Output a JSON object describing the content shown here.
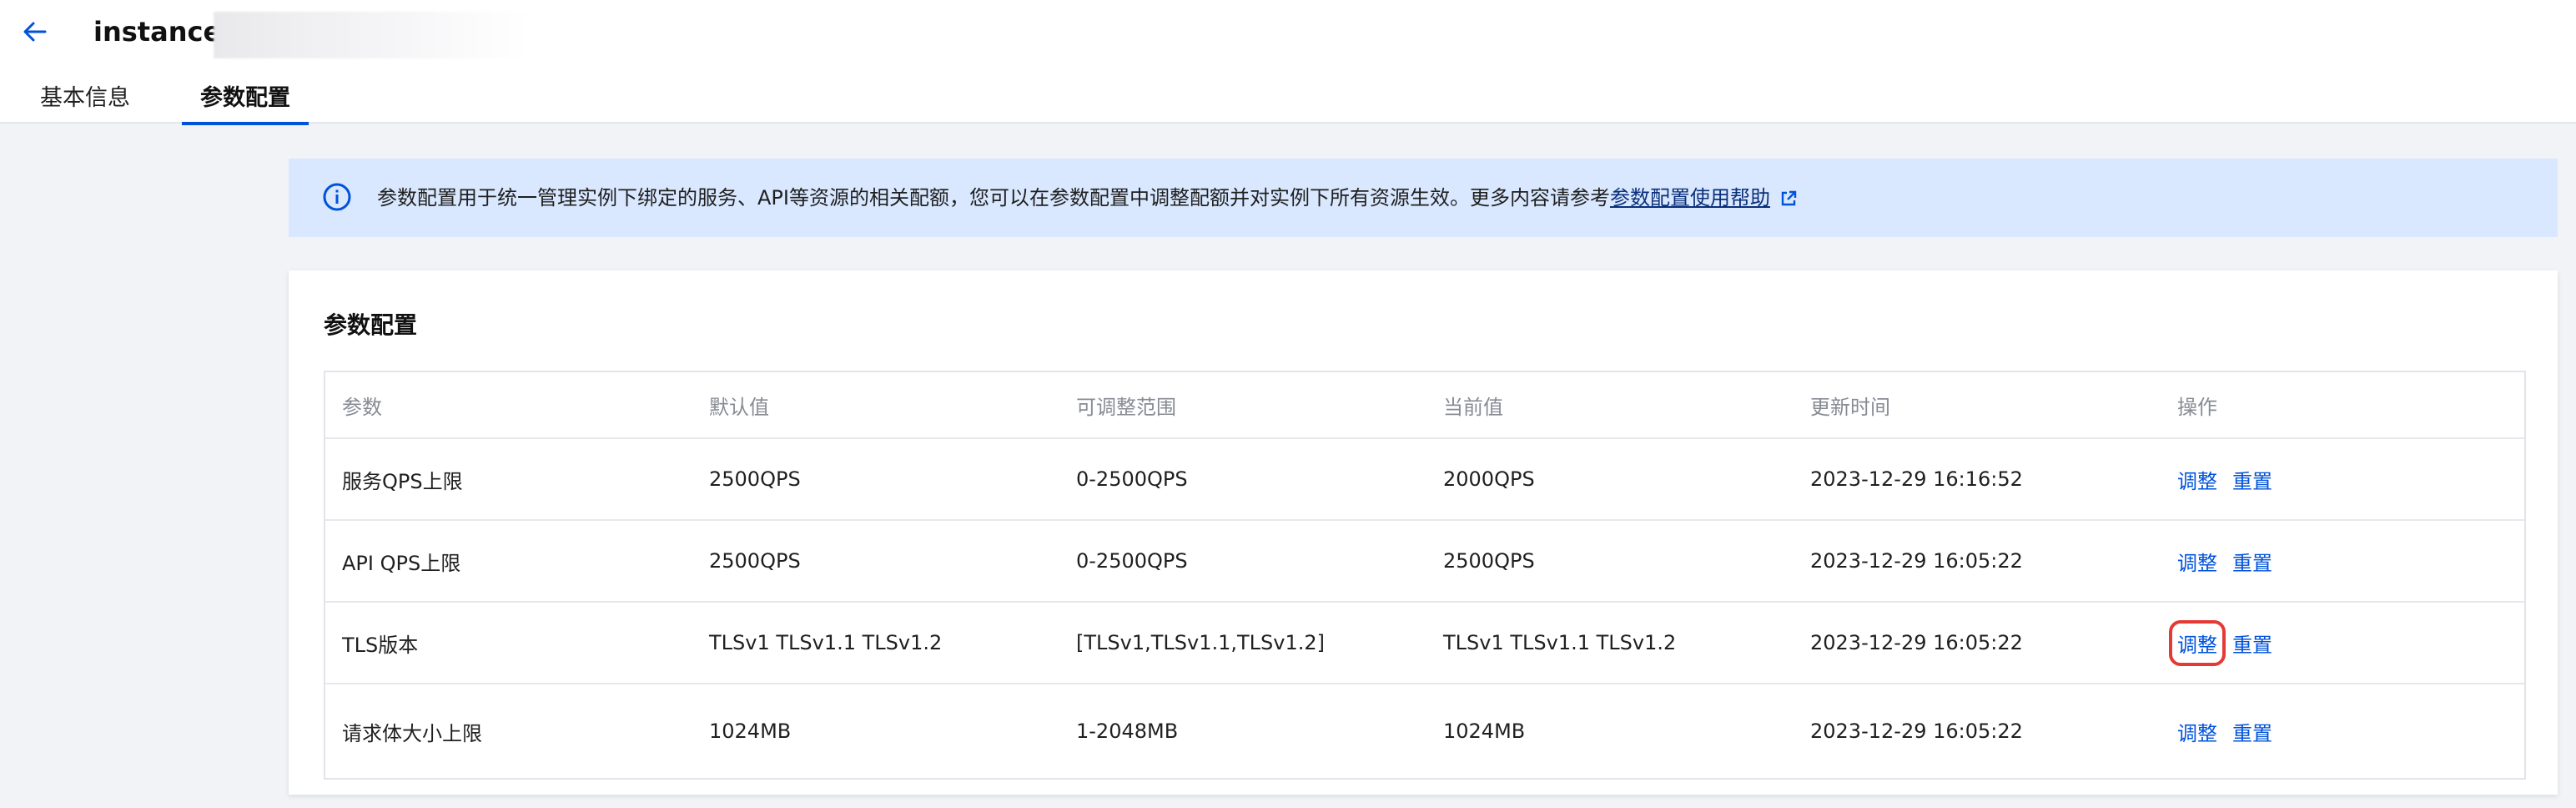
{
  "header": {
    "title": "instance-",
    "tabs": [
      {
        "label": "基本信息"
      },
      {
        "label": "参数配置"
      }
    ]
  },
  "notice": {
    "text": "参数配置用于统一管理实例下绑定的服务、API等资源的相关配额，您可以在参数配置中调整配额并对实例下所有资源生效。更多内容请参考",
    "link": "参数配置使用帮助"
  },
  "card": {
    "title": "参数配置",
    "columns": [
      "参数",
      "默认值",
      "可调整范围",
      "当前值",
      "更新时间",
      "操作"
    ],
    "rows": [
      {
        "param": "服务QPS上限",
        "default": "2500QPS",
        "range": "0-2500QPS",
        "current": "2000QPS",
        "updated": "2023-12-29 16:16:52",
        "adjust": "调整",
        "reset": "重置"
      },
      {
        "param": "API QPS上限",
        "default": "2500QPS",
        "range": "0-2500QPS",
        "current": "2500QPS",
        "updated": "2023-12-29 16:05:22",
        "adjust": "调整",
        "reset": "重置"
      },
      {
        "param": "TLS版本",
        "default": "TLSv1 TLSv1.1 TLSv1.2",
        "range": "[TLSv1,TLSv1.1,TLSv1.2]",
        "current": "TLSv1 TLSv1.1 TLSv1.2",
        "updated": "2023-12-29 16:05:22",
        "adjust": "调整",
        "reset": "重置"
      },
      {
        "param": "请求体大小上限",
        "default": "1024MB",
        "range": "1-2048MB",
        "current": "1024MB",
        "updated": "2023-12-29 16:05:22",
        "adjust": "调整",
        "reset": "重置"
      }
    ]
  },
  "colors": {
    "accent": "#0052d9",
    "notice_bg": "#d9e8ff",
    "highlight": "#e53935"
  },
  "icons": {
    "back": "arrow-left-icon",
    "info": "info-circle-icon",
    "external": "external-link-icon"
  }
}
